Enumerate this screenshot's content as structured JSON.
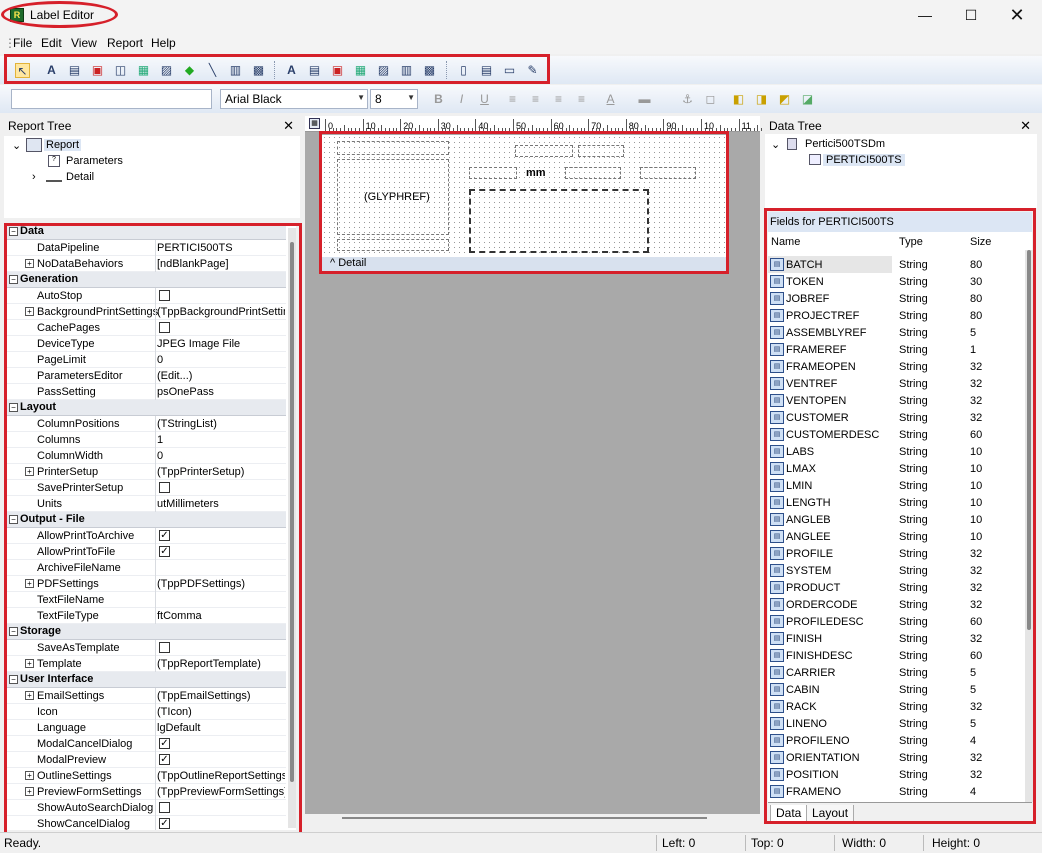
{
  "window": {
    "title": "Label Editor",
    "app_icon": "reportbuilder-icon"
  },
  "menu": [
    "File",
    "Edit",
    "View",
    "Report",
    "Help"
  ],
  "toolbar_format": {
    "font_name": "Arial Black",
    "font_size": "8"
  },
  "report_tree": {
    "title": "Report Tree",
    "items": [
      {
        "label": "Report"
      },
      {
        "label": "Parameters"
      },
      {
        "label": "Detail"
      }
    ]
  },
  "properties": [
    {
      "category": "Data",
      "rows": [
        {
          "name": "DataPipeline",
          "value": "PERTICI500TS"
        },
        {
          "name": "NoDataBehaviors",
          "value": "[ndBlankPage]",
          "expand": true
        }
      ]
    },
    {
      "category": "Generation",
      "rows": [
        {
          "name": "AutoStop",
          "check": false
        },
        {
          "name": "BackgroundPrintSettings",
          "value": "(TppBackgroundPrintSettin",
          "expand": true
        },
        {
          "name": "CachePages",
          "check": false
        },
        {
          "name": "DeviceType",
          "value": "JPEG Image File"
        },
        {
          "name": "PageLimit",
          "value": "0"
        },
        {
          "name": "ParametersEditor",
          "value": "(Edit...)"
        },
        {
          "name": "PassSetting",
          "value": "psOnePass"
        }
      ]
    },
    {
      "category": "Layout",
      "rows": [
        {
          "name": "ColumnPositions",
          "value": "(TStringList)"
        },
        {
          "name": "Columns",
          "value": "1"
        },
        {
          "name": "ColumnWidth",
          "value": "0"
        },
        {
          "name": "PrinterSetup",
          "value": "(TppPrinterSetup)",
          "expand": true
        },
        {
          "name": "SavePrinterSetup",
          "check": false
        },
        {
          "name": "Units",
          "value": "utMillimeters"
        }
      ]
    },
    {
      "category": "Output - File",
      "rows": [
        {
          "name": "AllowPrintToArchive",
          "check": true
        },
        {
          "name": "AllowPrintToFile",
          "check": true
        },
        {
          "name": "ArchiveFileName",
          "value": ""
        },
        {
          "name": "PDFSettings",
          "value": "(TppPDFSettings)",
          "expand": true
        },
        {
          "name": "TextFileName",
          "value": ""
        },
        {
          "name": "TextFileType",
          "value": "ftComma"
        }
      ]
    },
    {
      "category": "Storage",
      "rows": [
        {
          "name": "SaveAsTemplate",
          "check": false
        },
        {
          "name": "Template",
          "value": "(TppReportTemplate)",
          "expand": true
        }
      ]
    },
    {
      "category": "User Interface",
      "rows": [
        {
          "name": "EmailSettings",
          "value": "(TppEmailSettings)",
          "expand": true
        },
        {
          "name": "Icon",
          "value": "(TIcon)"
        },
        {
          "name": "Language",
          "value": "lgDefault"
        },
        {
          "name": "ModalCancelDialog",
          "check": true
        },
        {
          "name": "ModalPreview",
          "check": true
        },
        {
          "name": "OutlineSettings",
          "value": "(TppOutlineReportSettings",
          "expand": true
        },
        {
          "name": "PreviewFormSettings",
          "value": "(TppPreviewFormSettings)",
          "expand": true
        },
        {
          "name": "ShowAutoSearchDialog",
          "check": false
        },
        {
          "name": "ShowCancelDialog",
          "check": true
        }
      ]
    }
  ],
  "designer": {
    "ruler_labels": [
      "0",
      "10",
      "20",
      "30",
      "40",
      "50",
      "60",
      "70",
      "80",
      "90",
      "10",
      "11"
    ],
    "glyph_label": "(GLYPHREF)",
    "mm_label": "mm",
    "band_label": "^ Detail"
  },
  "data_tree": {
    "title": "Data Tree",
    "root": "Pertici500TSDm",
    "child": "PERTICI500TS"
  },
  "fields": {
    "title": "Fields for PERTICI500TS",
    "headers": [
      "Name",
      "Type",
      "Size"
    ],
    "rows": [
      {
        "name": "BATCH",
        "type": "String",
        "size": "80"
      },
      {
        "name": "TOKEN",
        "type": "String",
        "size": "30"
      },
      {
        "name": "JOBREF",
        "type": "String",
        "size": "80"
      },
      {
        "name": "PROJECTREF",
        "type": "String",
        "size": "80"
      },
      {
        "name": "ASSEMBLYREF",
        "type": "String",
        "size": "5"
      },
      {
        "name": "FRAMEREF",
        "type": "String",
        "size": "1"
      },
      {
        "name": "FRAMEOPEN",
        "type": "String",
        "size": "32"
      },
      {
        "name": "VENTREF",
        "type": "String",
        "size": "32"
      },
      {
        "name": "VENTOPEN",
        "type": "String",
        "size": "32"
      },
      {
        "name": "CUSTOMER",
        "type": "String",
        "size": "32"
      },
      {
        "name": "CUSTOMERDESC",
        "type": "String",
        "size": "60"
      },
      {
        "name": "LABS",
        "type": "String",
        "size": "10"
      },
      {
        "name": "LMAX",
        "type": "String",
        "size": "10"
      },
      {
        "name": "LMIN",
        "type": "String",
        "size": "10"
      },
      {
        "name": "LENGTH",
        "type": "String",
        "size": "10"
      },
      {
        "name": "ANGLEB",
        "type": "String",
        "size": "10"
      },
      {
        "name": "ANGLEE",
        "type": "String",
        "size": "10"
      },
      {
        "name": "PROFILE",
        "type": "String",
        "size": "32"
      },
      {
        "name": "SYSTEM",
        "type": "String",
        "size": "32"
      },
      {
        "name": "PRODUCT",
        "type": "String",
        "size": "32"
      },
      {
        "name": "ORDERCODE",
        "type": "String",
        "size": "32"
      },
      {
        "name": "PROFILEDESC",
        "type": "String",
        "size": "60"
      },
      {
        "name": "FINISH",
        "type": "String",
        "size": "32"
      },
      {
        "name": "FINISHDESC",
        "type": "String",
        "size": "60"
      },
      {
        "name": "CARRIER",
        "type": "String",
        "size": "5"
      },
      {
        "name": "CABIN",
        "type": "String",
        "size": "5"
      },
      {
        "name": "RACK",
        "type": "String",
        "size": "32"
      },
      {
        "name": "LINENO",
        "type": "String",
        "size": "5"
      },
      {
        "name": "PROFILENO",
        "type": "String",
        "size": "4"
      },
      {
        "name": "ORIENTATION",
        "type": "String",
        "size": "32"
      },
      {
        "name": "POSITION",
        "type": "String",
        "size": "32"
      },
      {
        "name": "FRAMENO",
        "type": "String",
        "size": "4"
      }
    ]
  },
  "tabs": [
    "Data",
    "Layout"
  ],
  "status": {
    "text": "Ready.",
    "left": "Left: 0",
    "top": "Top: 0",
    "width": "Width: 0",
    "height": "Height: 0"
  },
  "colors": {
    "highlight": "#d6202a"
  }
}
